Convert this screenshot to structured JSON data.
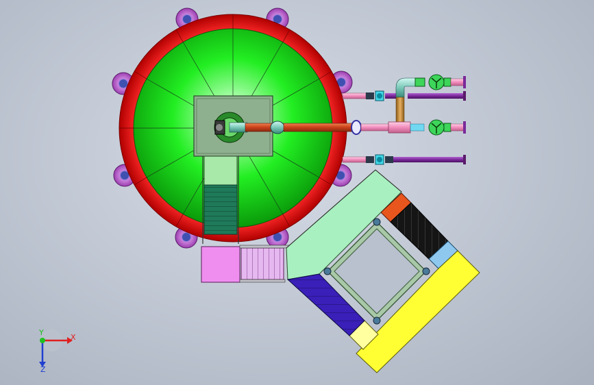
{
  "viewport": {
    "background_inner": "#d6dce6",
    "background_outer": "#a9b1bf"
  },
  "model": {
    "tank_rim_color": "#e81414",
    "tank_dome_color": "#18e818",
    "flange_color": "#c060c0",
    "platform_color": "#8fb08f",
    "walkway_color": "#a8f0a8",
    "stair_color": "#1f7a5a",
    "pink_deck_color": "#f08ef0",
    "stair_rail_color": "#c890e8",
    "blue_stair_color": "#3a1fb8",
    "yellow_deck_color": "#ffff33",
    "black_stair_color": "#1a1a1a",
    "orange_block_color": "#e8561e",
    "light_blue_block_color": "#8fc8ef",
    "pipe_orange_color": "#d4501e",
    "pipe_pink_color": "#f2a0c8",
    "pipe_purple_color": "#7a2a9a",
    "valve_green_color": "#3dd65a",
    "pipe_bronze_color": "#c08a30"
  },
  "triad": {
    "x_label": "X",
    "y_label": "Y",
    "z_label": "Z",
    "x_color": "#e02020",
    "y_color": "#20c020",
    "z_color": "#2040d0"
  }
}
